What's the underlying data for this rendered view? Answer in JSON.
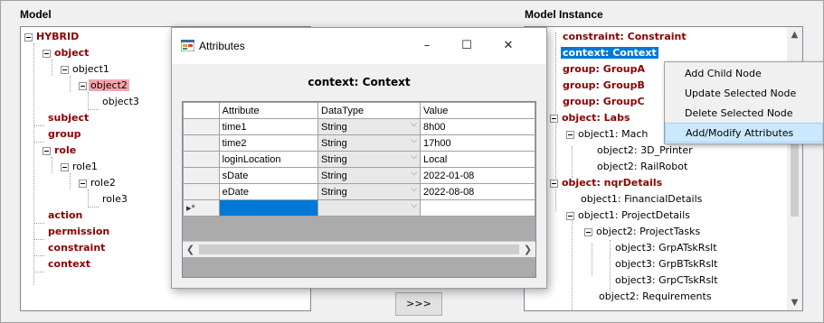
{
  "model": {
    "title": "Model",
    "tree": [
      {
        "label": "HYBRID",
        "dark": true
      },
      {
        "label": "object",
        "dark": true
      },
      {
        "label": "object1",
        "dark": false
      },
      {
        "label": "object2",
        "dark": true,
        "highlight": "pink"
      },
      {
        "label": "object3",
        "dark": false
      },
      {
        "label": "subject",
        "dark": true
      },
      {
        "label": "group",
        "dark": true
      },
      {
        "label": "role",
        "dark": true
      },
      {
        "label": "role1",
        "dark": false
      },
      {
        "label": "role2",
        "dark": false
      },
      {
        "label": "role3",
        "dark": false
      },
      {
        "label": "action",
        "dark": true
      },
      {
        "label": "permission",
        "dark": true
      },
      {
        "label": "constraint",
        "dark": true
      },
      {
        "label": "context",
        "dark": true
      }
    ]
  },
  "transfer_button": ">>>",
  "instance": {
    "title": "Model Instance",
    "tree": [
      {
        "label": "constraint: Constraint",
        "dark": true
      },
      {
        "label": "context: Context",
        "dark": true,
        "highlight": "blue"
      },
      {
        "label": "group: GroupA",
        "dark": true
      },
      {
        "label": "group: GroupB",
        "dark": true
      },
      {
        "label": "group: GroupC",
        "dark": true
      },
      {
        "label": "object: Labs",
        "dark": true
      },
      {
        "label": "object1: Mach",
        "dark": false
      },
      {
        "label": "object2: 3D_Printer",
        "dark": false
      },
      {
        "label": "object2: RailRobot",
        "dark": false
      },
      {
        "label": "object: nqrDetails",
        "dark": true
      },
      {
        "label": "object1: FinancialDetails",
        "dark": false
      },
      {
        "label": "object1: ProjectDetails",
        "dark": false
      },
      {
        "label": "object2: ProjectTasks",
        "dark": false
      },
      {
        "label": "object3: GrpATskRslt",
        "dark": false
      },
      {
        "label": "object3: GrpBTskRslt",
        "dark": false
      },
      {
        "label": "object3: GrpCTskRslt",
        "dark": false
      },
      {
        "label": "object2: Requirements",
        "dark": false
      }
    ]
  },
  "context_menu": {
    "items": [
      "Add Child Node",
      "Update Selected Node",
      "Delete Selected Node",
      "Add/Modify Attributes"
    ]
  },
  "dialog": {
    "title": "Attributes",
    "controls": {
      "minimize": "–",
      "maximize": "☐",
      "close": "✕"
    },
    "heading": "context: Context",
    "columns": [
      "Attribute",
      "DataType",
      "Value"
    ],
    "rows": [
      {
        "attribute": "time1",
        "datatype": "String",
        "value": "8h00"
      },
      {
        "attribute": "time2",
        "datatype": "String",
        "value": "17h00"
      },
      {
        "attribute": "loginLocation",
        "datatype": "String",
        "value": "Local"
      },
      {
        "attribute": "sDate",
        "datatype": "String",
        "value": "2022-01-08"
      },
      {
        "attribute": "eDate",
        "datatype": "String",
        "value": "2022-08-08"
      }
    ],
    "new_row_marker": "▸*"
  },
  "colors": {
    "dark_node": "#8b0000",
    "selection_blue": "#0078d7",
    "highlight_pink": "#f4a6ad",
    "menu_hover": "#cce8ff"
  }
}
